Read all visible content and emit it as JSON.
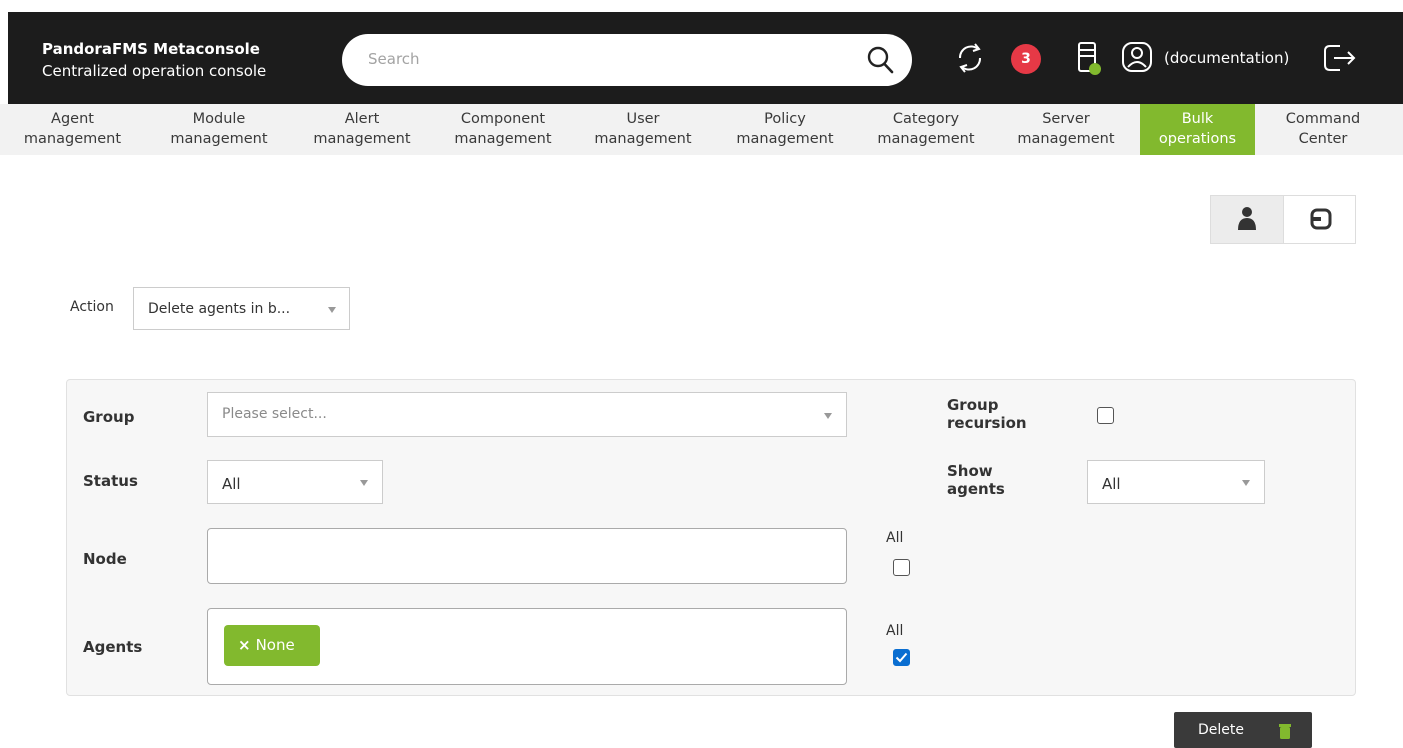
{
  "header": {
    "brand_title": "PandoraFMS Metaconsole",
    "brand_subtitle": "Centralized operation console",
    "search_placeholder": "Search",
    "notifications_count": "3",
    "username": "(documentation)"
  },
  "nav": {
    "items": [
      {
        "line1": "Agent",
        "line2": "management"
      },
      {
        "line1": "Module",
        "line2": "management"
      },
      {
        "line1": "Alert",
        "line2": "management"
      },
      {
        "line1": "Component",
        "line2": "management"
      },
      {
        "line1": "User",
        "line2": "management"
      },
      {
        "line1": "Policy",
        "line2": "management"
      },
      {
        "line1": "Category",
        "line2": "management"
      },
      {
        "line1": "Server",
        "line2": "management"
      },
      {
        "line1": "Bulk",
        "line2": "operations"
      },
      {
        "line1": "Command",
        "line2": "Center"
      }
    ],
    "active_index": 8
  },
  "action": {
    "label": "Action",
    "selected": "Delete agents in b..."
  },
  "form": {
    "group_label": "Group",
    "group_placeholder": "Please select...",
    "group_recursion_line1": "Group",
    "group_recursion_line2": "recursion",
    "status_label": "Status",
    "status_value": "All",
    "show_agents_line1": "Show",
    "show_agents_line2": "agents",
    "show_agents_value": "All",
    "node_label": "Node",
    "node_all_label": "All",
    "agents_label": "Agents",
    "agents_tag": "None",
    "agents_all_label": "All"
  },
  "buttons": {
    "delete_label": "Delete"
  },
  "colors": {
    "accent": "#82b92e",
    "header_bg": "#1c1c1c",
    "badge": "#e63946",
    "checkbox_checked": "#0a6ed1"
  }
}
